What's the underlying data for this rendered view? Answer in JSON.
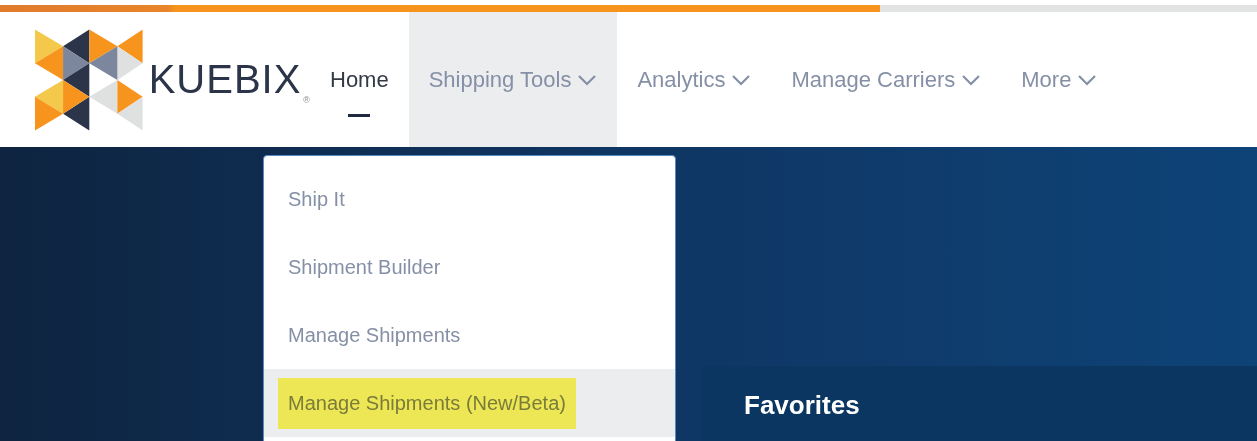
{
  "progress": {
    "level": 0.7
  },
  "logo": {
    "name": "KUEBIX",
    "mark": "®"
  },
  "nav": [
    {
      "label": "Home",
      "selected": true,
      "expanded": false,
      "caret": false
    },
    {
      "label": "Shipping Tools",
      "selected": false,
      "expanded": true,
      "caret": true
    },
    {
      "label": "Analytics",
      "selected": false,
      "expanded": false,
      "caret": true
    },
    {
      "label": "Manage Carriers",
      "selected": false,
      "expanded": false,
      "caret": true
    },
    {
      "label": "More",
      "selected": false,
      "expanded": false,
      "caret": true
    }
  ],
  "dropdown": [
    {
      "label": "Ship It",
      "selected": false,
      "highlighted": false
    },
    {
      "label": "Shipment Builder",
      "selected": false,
      "highlighted": false
    },
    {
      "label": "Manage Shipments",
      "selected": false,
      "highlighted": false
    },
    {
      "label": "Manage Shipments (New/Beta)",
      "selected": true,
      "highlighted": true
    }
  ],
  "favorites": {
    "title": "Favorites"
  }
}
